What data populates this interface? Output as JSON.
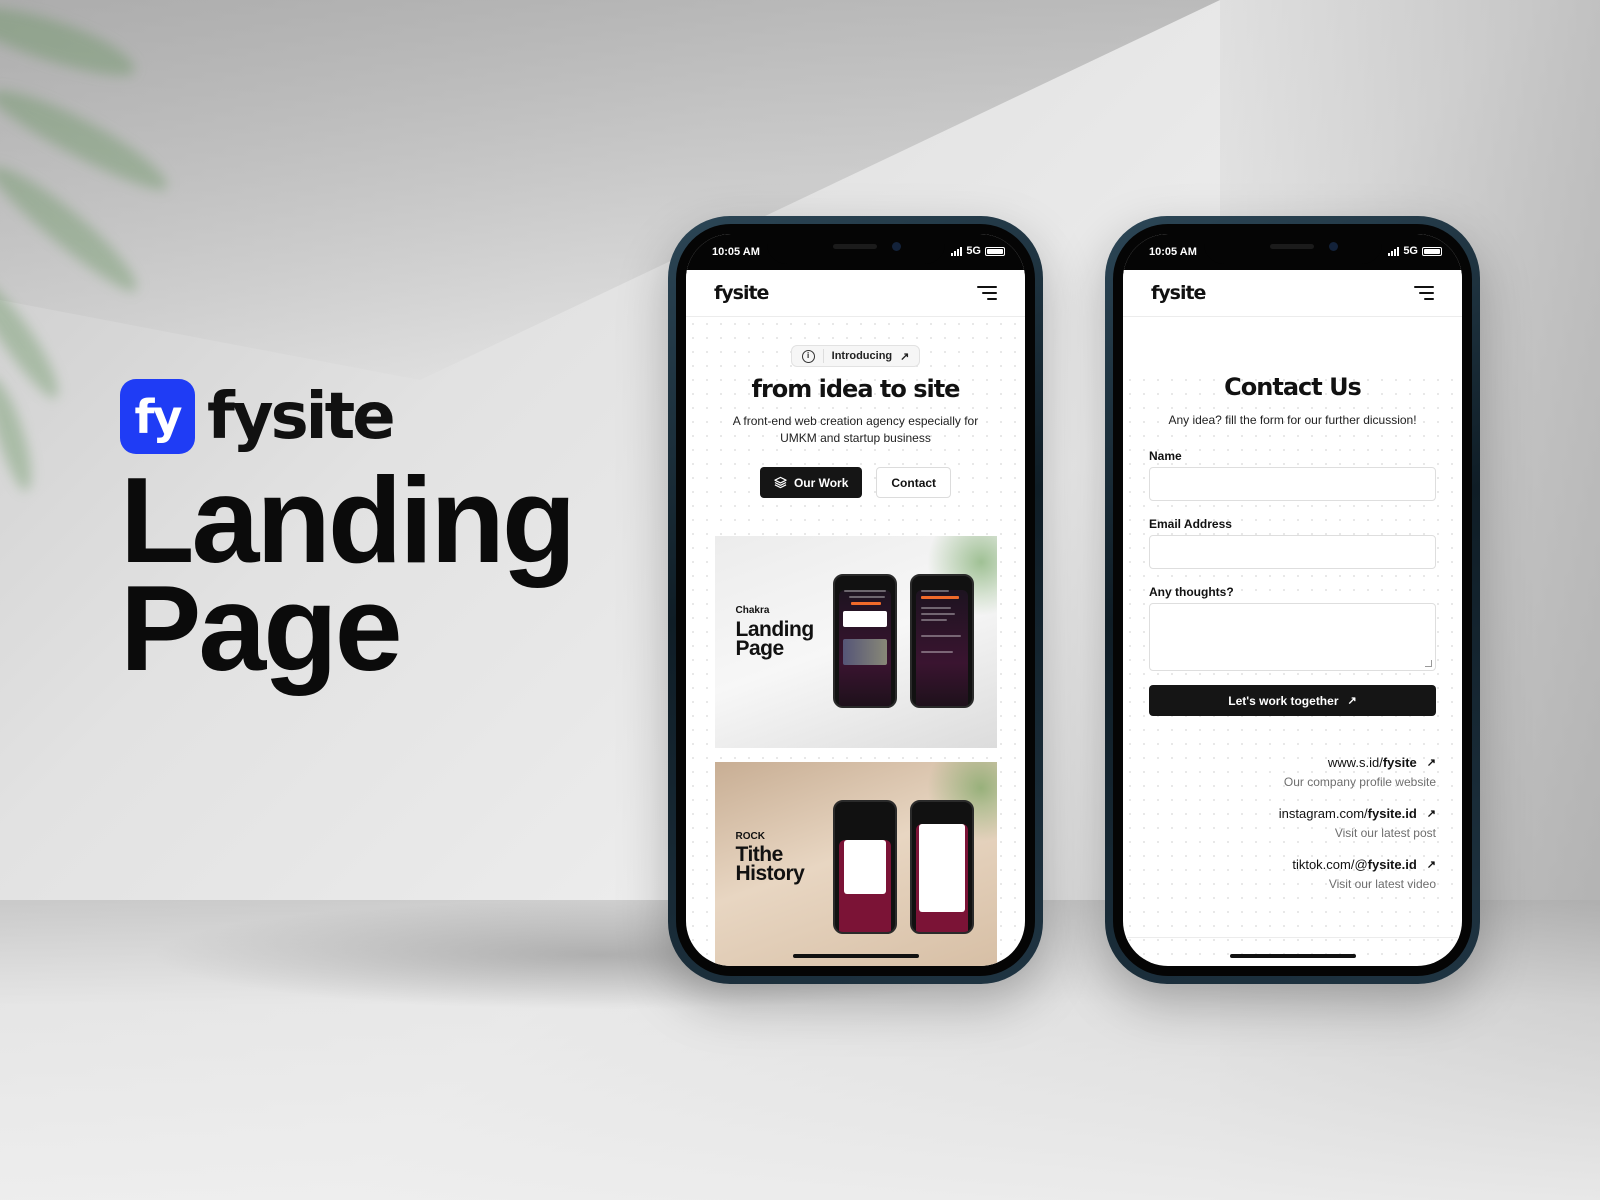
{
  "brand": {
    "logo_text": "fy",
    "name": "fysite",
    "logo_color": "#1f3cf5"
  },
  "hero": {
    "line1": "Landing",
    "line2": "Page"
  },
  "status_bar": {
    "time": "10:05 AM",
    "network": "5G"
  },
  "app_nav": {
    "logo": "fysite",
    "menu_icon": "menu-icon"
  },
  "home_screen": {
    "pill_label": "Introducing",
    "pill_arrow": "↗",
    "title": "from idea to site",
    "subtitle": "A front-end web creation agency especially for UMKM and startup business",
    "primary_button": "Our Work",
    "secondary_button": "Contact",
    "projects": [
      {
        "small": "Chakra",
        "title_line1": "Landing",
        "title_line2": "Page"
      },
      {
        "small": "ROCK",
        "title_line1": "Tithe",
        "title_line2": "History"
      }
    ]
  },
  "contact_screen": {
    "title": "Contact Us",
    "subtitle": "Any idea? fill the form for our further dicussion!",
    "fields": {
      "name_label": "Name",
      "email_label": "Email Address",
      "thoughts_label": "Any thoughts?"
    },
    "submit_label": "Let's work together",
    "submit_arrow": "↗",
    "links": [
      {
        "prefix": "www.s.id/",
        "bold": "fysite",
        "desc": "Our company profile website"
      },
      {
        "prefix": "instagram.com/",
        "bold": "fysite.id",
        "desc": "Visit our latest post"
      },
      {
        "prefix": "tiktok.com/@",
        "bold": "fysite.id",
        "desc": "Visit our latest video"
      }
    ]
  },
  "colors": {
    "dark_button": "#151515",
    "phone_frame": "#1f3442"
  }
}
